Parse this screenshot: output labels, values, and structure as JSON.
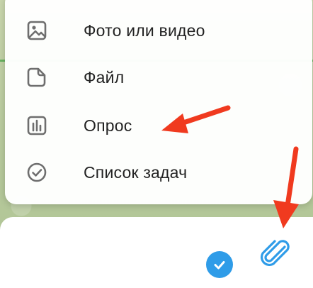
{
  "menu": {
    "items": [
      {
        "label": "Фото или видео",
        "icon": "photo-video-icon"
      },
      {
        "label": "Файл",
        "icon": "file-icon"
      },
      {
        "label": "Опрос",
        "icon": "poll-icon"
      },
      {
        "label": "Список задач",
        "icon": "checklist-icon"
      }
    ]
  },
  "input_bar": {
    "attach_icon": "paperclip-icon",
    "check_icon": "checkmark-icon"
  },
  "colors": {
    "accent": "#2f9ce8",
    "arrow": "#f03a1f",
    "icon_gray": "#6e6e6e"
  }
}
